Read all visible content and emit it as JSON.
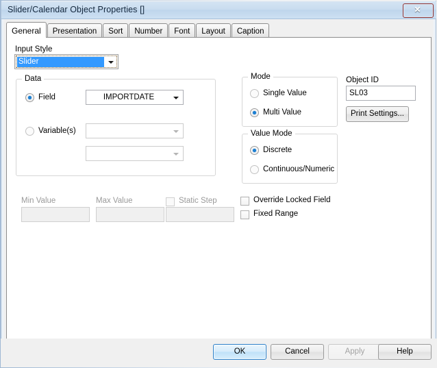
{
  "window": {
    "title": "Slider/Calendar Object Properties []",
    "close_glyph": "✕"
  },
  "tabs": [
    {
      "label": "General",
      "active": true
    },
    {
      "label": "Presentation",
      "active": false
    },
    {
      "label": "Sort",
      "active": false
    },
    {
      "label": "Number",
      "active": false
    },
    {
      "label": "Font",
      "active": false
    },
    {
      "label": "Layout",
      "active": false
    },
    {
      "label": "Caption",
      "active": false
    }
  ],
  "general": {
    "input_style": {
      "label": "Input Style",
      "value": "Slider"
    },
    "data_group": {
      "title": "Data",
      "field_radio_label": "Field",
      "field_radio_selected": true,
      "field_value": "IMPORTDATE",
      "variables_radio_label": "Variable(s)",
      "variables_radio_selected": false,
      "variable1_value": "",
      "variable2_value": ""
    },
    "mode_group": {
      "title": "Mode",
      "options": [
        {
          "label": "Single Value",
          "selected": false
        },
        {
          "label": "Multi Value",
          "selected": true
        }
      ]
    },
    "value_mode_group": {
      "title": "Value Mode",
      "options": [
        {
          "label": "Discrete",
          "selected": true
        },
        {
          "label": "Continuous/Numeric",
          "selected": false
        }
      ]
    },
    "object_id": {
      "label": "Object ID",
      "value": "SL03"
    },
    "print_settings_label": "Print Settings...",
    "min_value": {
      "label": "Min Value",
      "value": "",
      "enabled": false
    },
    "max_value": {
      "label": "Max Value",
      "value": "",
      "enabled": false
    },
    "static_step": {
      "label": "Static Step",
      "checked": false,
      "enabled": false,
      "value": ""
    },
    "override_locked_field": {
      "label": "Override Locked Field",
      "checked": false
    },
    "fixed_range": {
      "label": "Fixed Range",
      "checked": false
    }
  },
  "footer": {
    "ok_label": "OK",
    "cancel_label": "Cancel",
    "apply_label": "Apply",
    "help_label": "Help"
  },
  "colors": {
    "titlebar": "#c9dcef",
    "selection": "#3399ff",
    "radio_dot": "#1a7fd4",
    "close_button": "#c44032",
    "default_button_border": "#2c80c9"
  }
}
